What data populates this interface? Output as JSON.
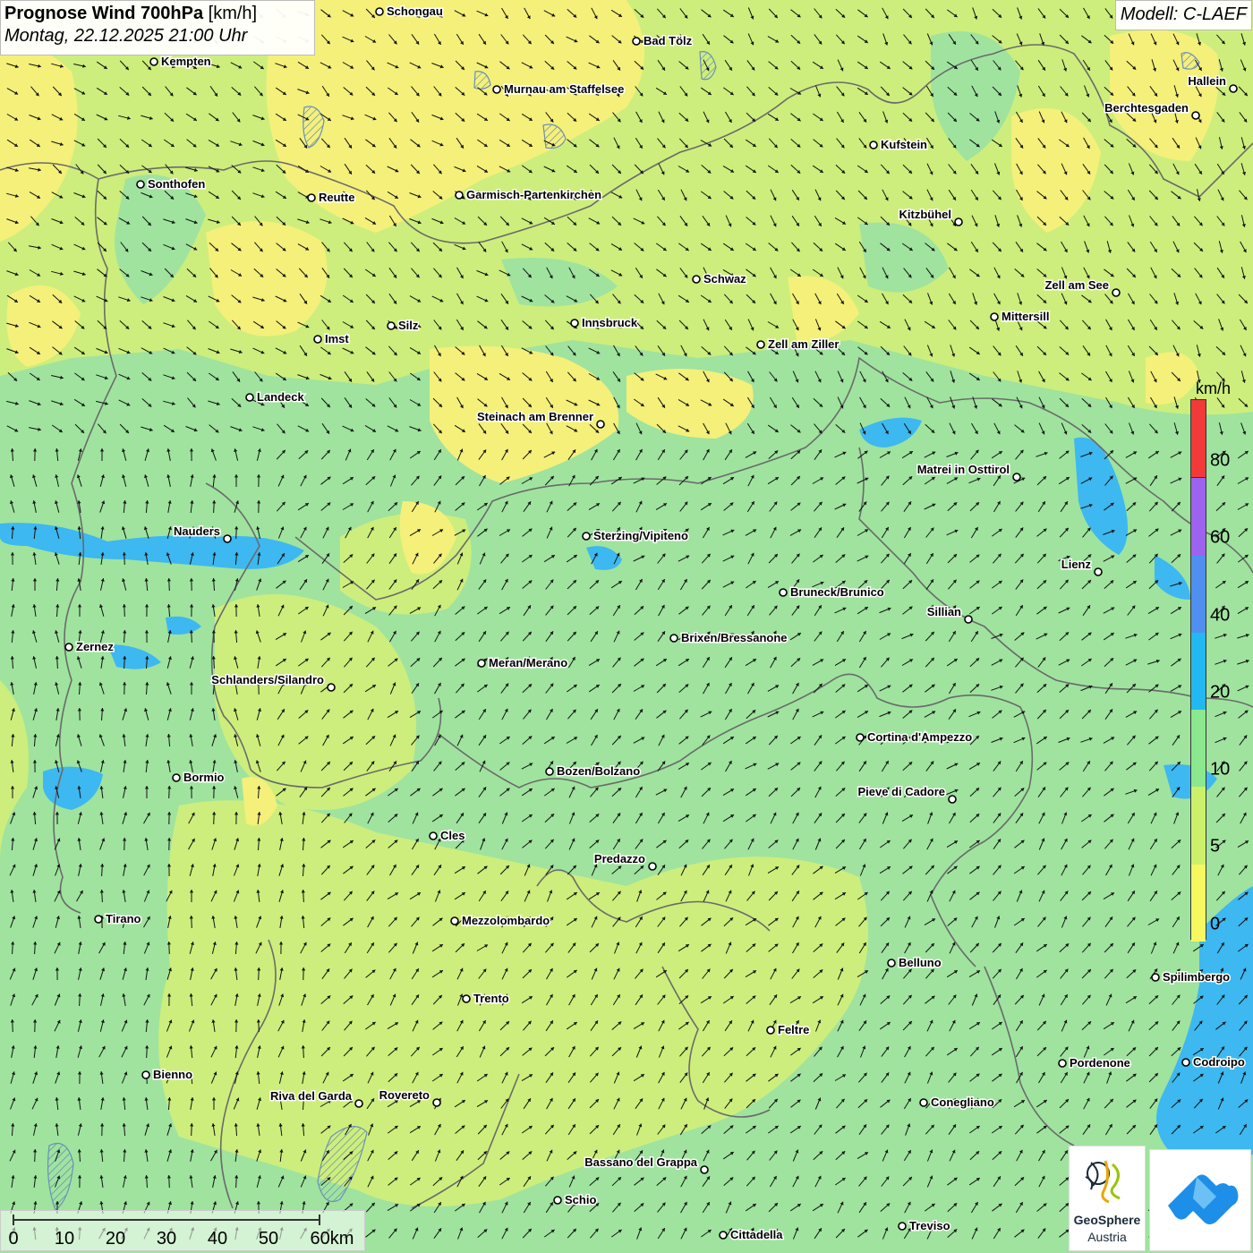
{
  "header": {
    "title_bold": "Prognose Wind 700hPa",
    "title_unit": "[km/h]",
    "subtitle": "Montag, 22.12.2025 21:00 Uhr",
    "model": "Modell: C-LAEF"
  },
  "legend": {
    "unit": "km/h",
    "bands": [
      {
        "label": "0",
        "color": "#f7f760"
      },
      {
        "label": "5",
        "color": "#cdf06a"
      },
      {
        "label": "10",
        "color": "#8ce88e"
      },
      {
        "label": "20",
        "color": "#22b9f2"
      },
      {
        "label": "40",
        "color": "#4f8ff0"
      },
      {
        "label": "60",
        "color": "#9d63f0"
      },
      {
        "label": "80",
        "color": "#f23a3a"
      }
    ]
  },
  "scalebar": {
    "labels": [
      "0",
      "10",
      "20",
      "30",
      "40",
      "50",
      "60km"
    ]
  },
  "places": [
    {
      "name": "Schongau",
      "label_side": "right"
    },
    {
      "name": "Bad Tölz",
      "label_side": "right"
    },
    {
      "name": "Kempten",
      "label_side": "right"
    },
    {
      "name": "Murnau am Staffelsee",
      "label_side": "right"
    },
    {
      "name": "Hallein",
      "label_side": "left"
    },
    {
      "name": "Berchtesgaden",
      "label_side": "left"
    },
    {
      "name": "Kufstein",
      "label_side": "right"
    },
    {
      "name": "Sonthofen",
      "label_side": "right"
    },
    {
      "name": "Reutte",
      "label_side": "right"
    },
    {
      "name": "Garmisch-Partenkirchen",
      "label_side": "right"
    },
    {
      "name": "Kitzbühel",
      "label_side": "left"
    },
    {
      "name": "Schwaz",
      "label_side": "right"
    },
    {
      "name": "Zell am See",
      "label_side": "left"
    },
    {
      "name": "Mittersill",
      "label_side": "right"
    },
    {
      "name": "Innsbruck",
      "label_side": "right"
    },
    {
      "name": "Silz",
      "label_side": "right"
    },
    {
      "name": "Imst",
      "label_side": "right"
    },
    {
      "name": "Zell am Ziller",
      "label_side": "right"
    },
    {
      "name": "Landeck",
      "label_side": "right"
    },
    {
      "name": "Steinach am Brenner",
      "label_side": "left"
    },
    {
      "name": "Matrei in Osttirol",
      "label_side": "left"
    },
    {
      "name": "Nauders",
      "label_side": "left"
    },
    {
      "name": "Sterzing/Vipiteno",
      "label_side": "right"
    },
    {
      "name": "Lienz",
      "label_side": "left"
    },
    {
      "name": "Bruneck/Brunico",
      "label_side": "right"
    },
    {
      "name": "Sillian",
      "label_side": "left"
    },
    {
      "name": "Brixen/Bressanone",
      "label_side": "right"
    },
    {
      "name": "Zernez",
      "label_side": "right"
    },
    {
      "name": "Meran/Merano",
      "label_side": "right"
    },
    {
      "name": "Schlanders/Silandro",
      "label_side": "left"
    },
    {
      "name": "Cortina d'Ampezzo",
      "label_side": "right"
    },
    {
      "name": "Bozen/Bolzano",
      "label_side": "right"
    },
    {
      "name": "Pieve di Cadore",
      "label_side": "left"
    },
    {
      "name": "Bormio",
      "label_side": "right"
    },
    {
      "name": "Cles",
      "label_side": "right"
    },
    {
      "name": "Predazzo",
      "label_side": "left"
    },
    {
      "name": "Tirano",
      "label_side": "right"
    },
    {
      "name": "Mezzolombardo",
      "label_side": "right"
    },
    {
      "name": "Belluno",
      "label_side": "right"
    },
    {
      "name": "Spilimbergo",
      "label_side": "right"
    },
    {
      "name": "Trento",
      "label_side": "right"
    },
    {
      "name": "Feltre",
      "label_side": "right"
    },
    {
      "name": "Pordenone",
      "label_side": "right"
    },
    {
      "name": "Codroipo",
      "label_side": "right"
    },
    {
      "name": "Bienno",
      "label_side": "right"
    },
    {
      "name": "Riva del Garda",
      "label_side": "left"
    },
    {
      "name": "Rovereto",
      "label_side": "left"
    },
    {
      "name": "Conegliano",
      "label_side": "right"
    },
    {
      "name": "Bassano del Grappa",
      "label_side": "left"
    },
    {
      "name": "Schio",
      "label_side": "right"
    },
    {
      "name": "Treviso",
      "label_side": "right"
    },
    {
      "name": "Cittadella",
      "label_side": "right"
    }
  ],
  "logos": {
    "geosphere_name": "GeoSphere",
    "geosphere_sub": "Austria"
  },
  "colors": {
    "field_yellow": "#f4f07a",
    "field_lightgreen": "#cdee7c",
    "field_green": "#9fe39f",
    "field_blue": "#3db8f0",
    "border": "#6a6a6a",
    "arrow": "#111111",
    "app_logo_blue": "#1e8fe8"
  }
}
